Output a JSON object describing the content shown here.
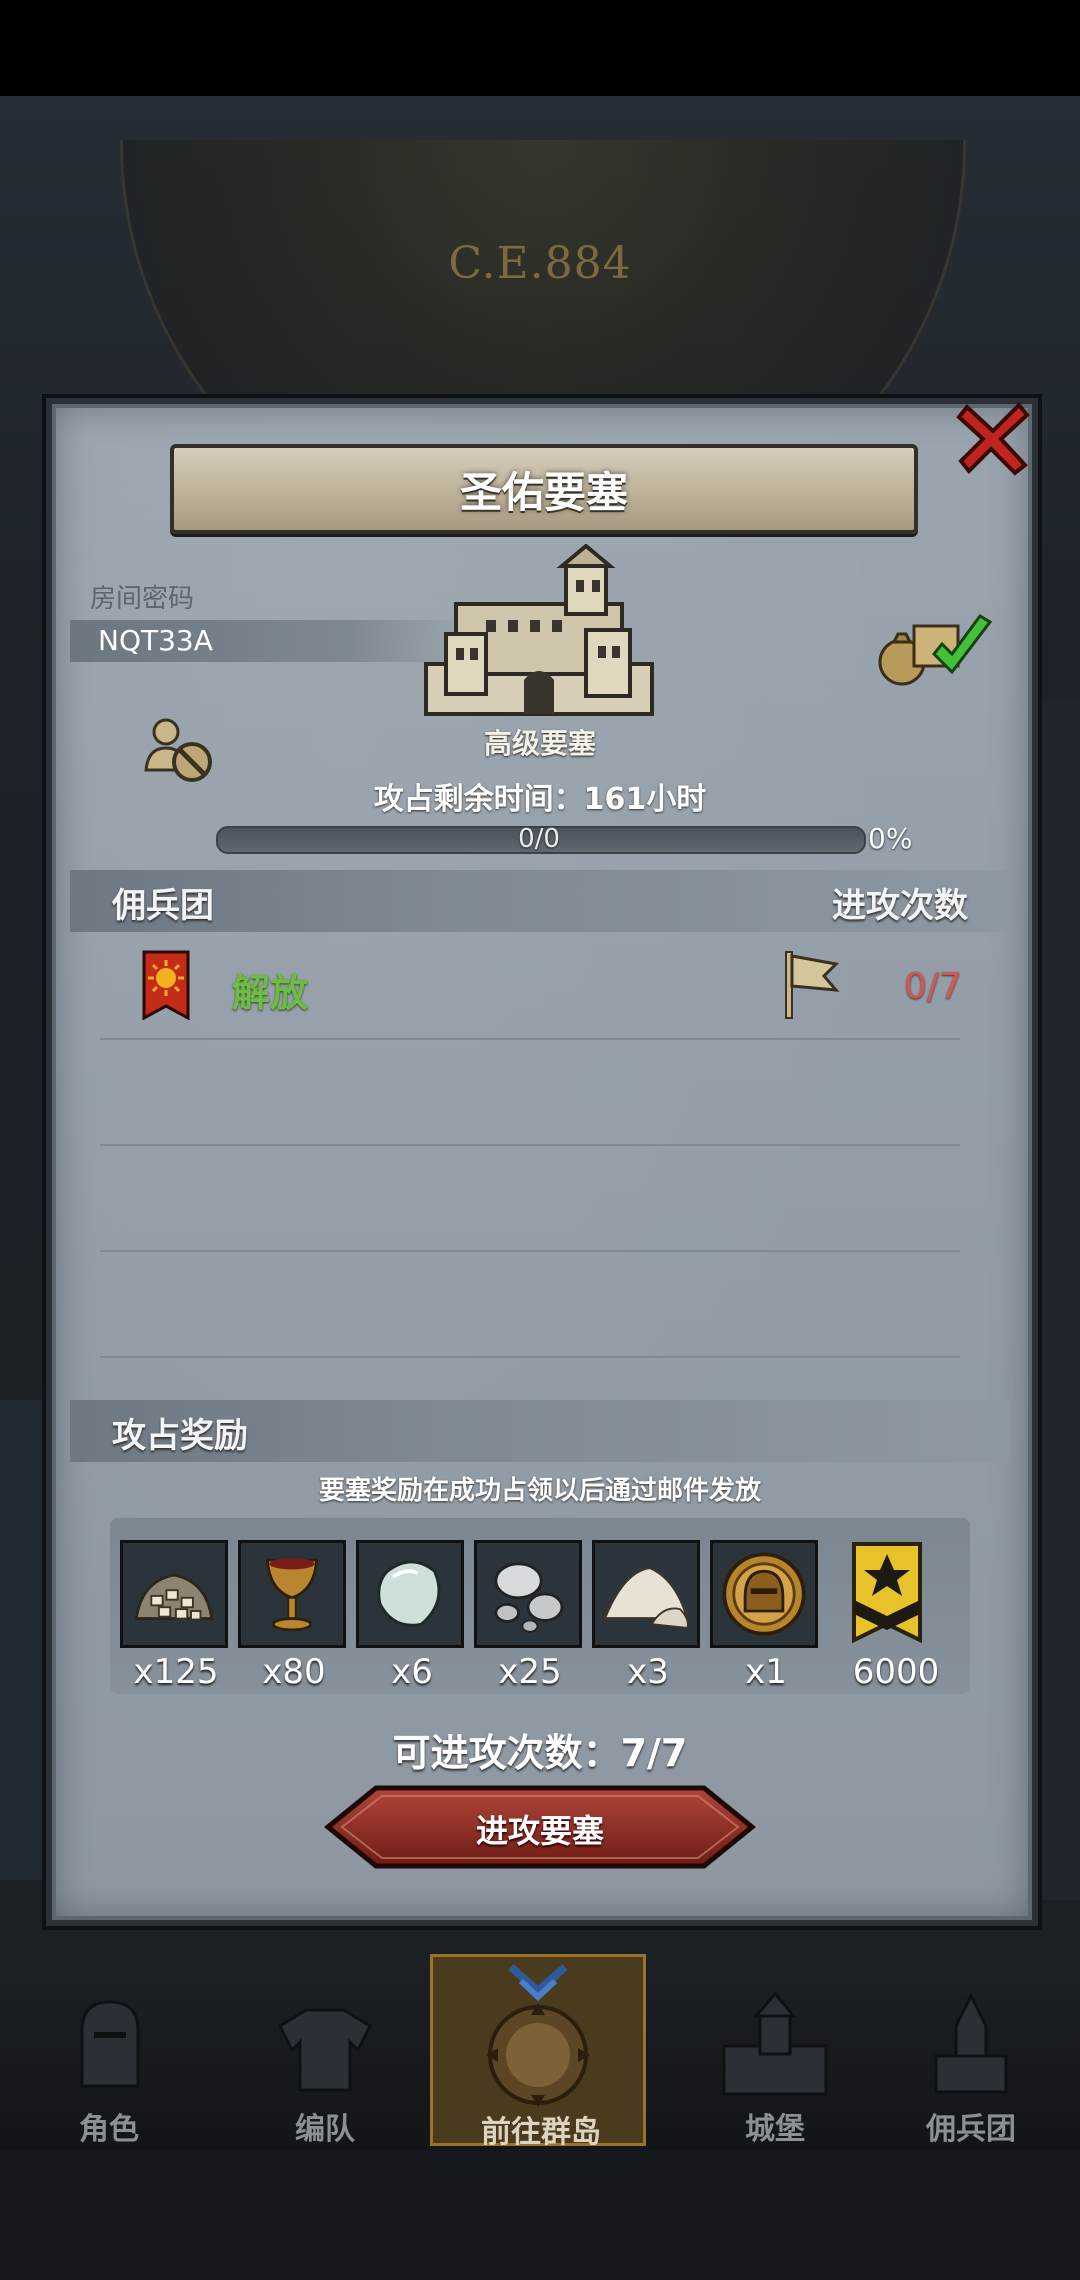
{
  "background": {
    "year": "C.E.884"
  },
  "dialog": {
    "title": "圣佑要塞",
    "room_label": "房间密码",
    "room_code": "NQT33A",
    "fort_type": "高级要塞",
    "timer_text": "攻占剩余时间：161小时",
    "progress": {
      "text": "0/0",
      "percent_label": "0%",
      "fraction": 0
    },
    "merc_header": "佣兵团",
    "attacks_header": "进攻次数",
    "mercenaries": [
      {
        "name": "解放",
        "count": "0/7"
      }
    ],
    "reward_header": "攻占奖励",
    "reward_note": "要塞奖励在成功占领以后通过邮件发放",
    "rewards": [
      {
        "icon": "ore-pile-icon",
        "qty": "x125"
      },
      {
        "icon": "goblet-icon",
        "qty": "x80"
      },
      {
        "icon": "gem-stone-icon",
        "qty": "x6"
      },
      {
        "icon": "silver-orbs-icon",
        "qty": "x25"
      },
      {
        "icon": "salt-pile-icon",
        "qty": "x3"
      },
      {
        "icon": "knight-helmet-medal-icon",
        "qty": "x1"
      },
      {
        "icon": "rank-badge-icon",
        "qty": "6000"
      }
    ],
    "attack_count_text": "可进攻次数：7/7",
    "attack_button": "进攻要塞"
  },
  "nav": {
    "tabs": [
      {
        "label": "角色",
        "icon": "knight-icon"
      },
      {
        "label": "编队",
        "icon": "armor-icon"
      },
      {
        "label": "前往群岛",
        "icon": "island-compass-icon",
        "active": true
      },
      {
        "label": "城堡",
        "icon": "castle-icon"
      },
      {
        "label": "佣兵团",
        "icon": "mercenary-icon"
      }
    ]
  },
  "colors": {
    "merc_name": "#6bbf3c",
    "attack_count_low": "#d8544e",
    "button_red": "#8c2a22",
    "panel": "#939ea8"
  }
}
